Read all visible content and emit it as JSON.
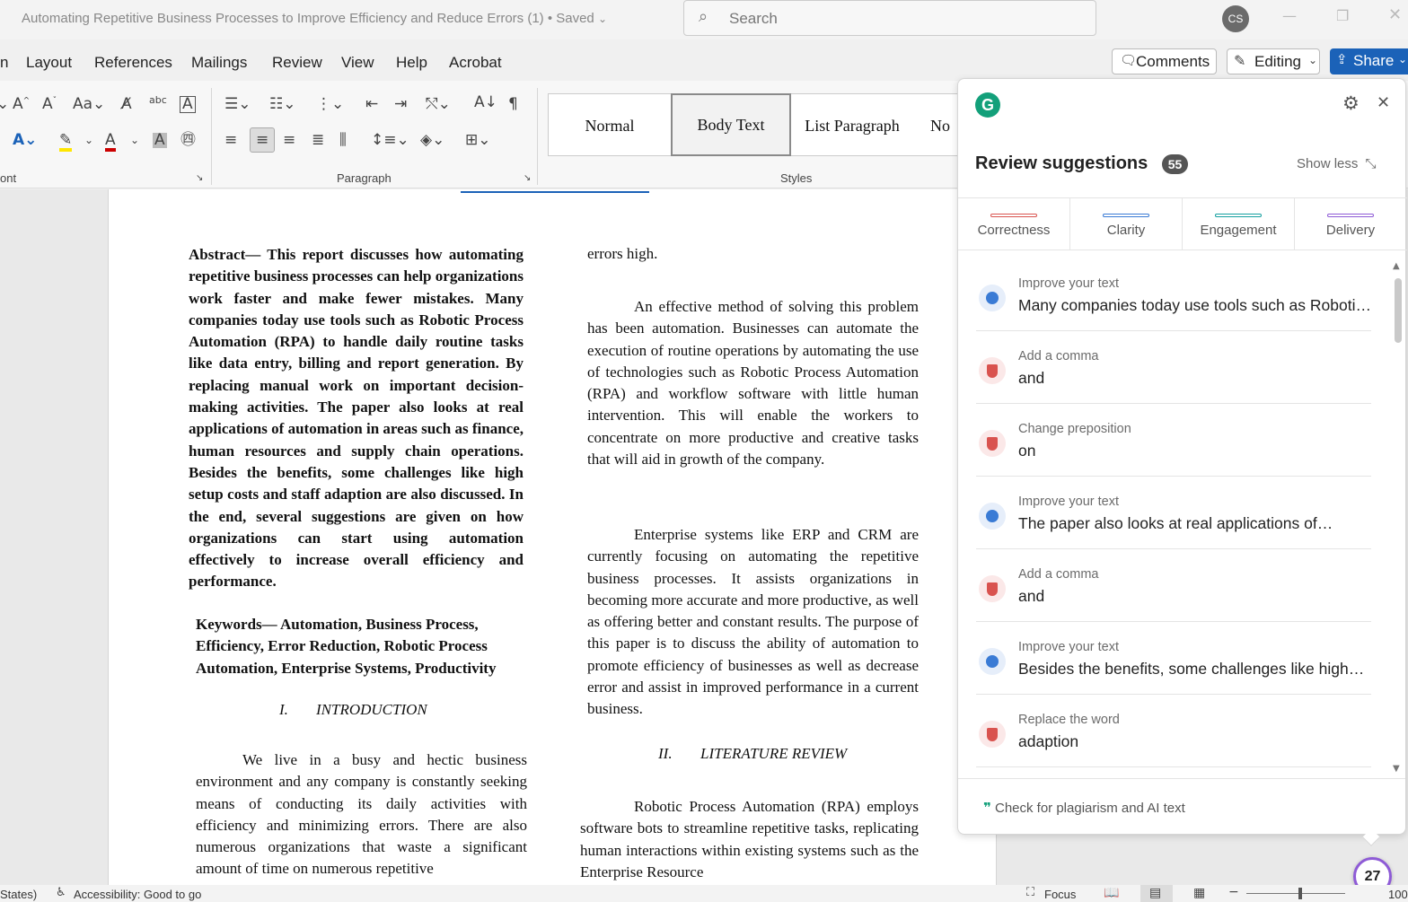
{
  "titlebar": {
    "doc_title": "Automating Repetitive Business Processes to Improve Efficiency and Reduce Errors (1)",
    "saved_status": "• Saved",
    "search_placeholder": "Search",
    "avatar_initials": "CS"
  },
  "menu": {
    "items": [
      "n",
      "Layout",
      "References",
      "Mailings",
      "Review",
      "View",
      "Help",
      "Acrobat"
    ],
    "comments_label": "Comments",
    "editing_label": "Editing",
    "share_label": "Share"
  },
  "ribbon": {
    "font_group_label": "ont",
    "paragraph_group_label": "Paragraph",
    "styles_group_label": "Styles",
    "styles": [
      "Normal",
      "Body Text",
      "List Paragraph",
      "No"
    ]
  },
  "document": {
    "abstract_label": "Abstract—",
    "abstract_text": "This report discusses how automating repetitive business processes can help organizations work faster and make fewer mistakes. Many companies today use tools such as Robotic Process Automation (RPA) to handle daily routine tasks like data entry, billing and report generation. By replacing manual work on important decision-making activities. The paper also looks at real applications of automation in areas such as finance, human resources and supply chain operations. Besides the benefits, some challenges like high setup costs and staff adaption are also discussed. In the end, several suggestions are given on how organizations can start using automation effectively to increase overall efficiency and performance.",
    "keywords_text": "Keywords— Automation, Business Process, Efficiency, Error Reduction, Robotic Process Automation, Enterprise Systems, Productivity",
    "intro_number": "I.",
    "intro_heading": "INTRODUCTION",
    "intro_text": "We live in a busy and hectic business environment and any company is constantly seeking means of conducting its daily activities with efficiency and minimizing errors. There are also numerous organizations that waste a significant amount of time on numerous repetitive",
    "right_para0": "errors high.",
    "right_para1": "An effective method of solving this problem has been automation. Businesses can automate the execution of routine operations by automating the use of technologies such as Robotic Process Automation (RPA) and workflow software with little human intervention. This will enable the workers to concentrate on more productive and creative tasks that will aid in growth of the company.",
    "right_para2": "Enterprise systems like ERP and CRM are currently focusing on automating the repetitive business processes. It assists organizations in becoming more accurate and more productive, as well as offering better and constant results. The purpose of this paper is to discuss the ability of automation to promote efficiency of businesses as well as decrease error and assist in improved performance in a current business.",
    "lit_number": "II.",
    "lit_heading": "LITERATURE REVIEW",
    "lit_text": "Robotic Process Automation (RPA) employs software bots to streamline repetitive tasks, replicating human interactions within existing systems such as the Enterprise Resource"
  },
  "grammarly": {
    "title": "Review suggestions",
    "count": "55",
    "show_less": "Show less",
    "tabs": [
      {
        "label": "Correctness",
        "color": "#d9534f"
      },
      {
        "label": "Clarity",
        "color": "#3a7bd5"
      },
      {
        "label": "Engagement",
        "color": "#15a0a0"
      },
      {
        "label": "Delivery",
        "color": "#8e5bd6"
      }
    ],
    "suggestions": [
      {
        "type": "Improve your text",
        "value": "Many companies today use tools such as Roboti…",
        "kind": "clarity"
      },
      {
        "type": "Add a comma",
        "value": "and",
        "kind": "correctness"
      },
      {
        "type": "Change preposition",
        "value": "on",
        "kind": "correctness"
      },
      {
        "type": "Improve your text",
        "value": "The paper also looks at real applications of…",
        "kind": "clarity"
      },
      {
        "type": "Add a comma",
        "value": "and",
        "kind": "correctness"
      },
      {
        "type": "Improve your text",
        "value": "Besides the benefits, some challenges like high…",
        "kind": "clarity"
      },
      {
        "type": "Replace the word",
        "value": "adaption",
        "kind": "correctness"
      }
    ],
    "plagiarism_label": "Check for plagiarism and AI text",
    "fab_count": "27"
  },
  "statusbar": {
    "language": "States)",
    "accessibility": "Accessibility: Good to go",
    "focus": "Focus",
    "zoom": "100"
  }
}
